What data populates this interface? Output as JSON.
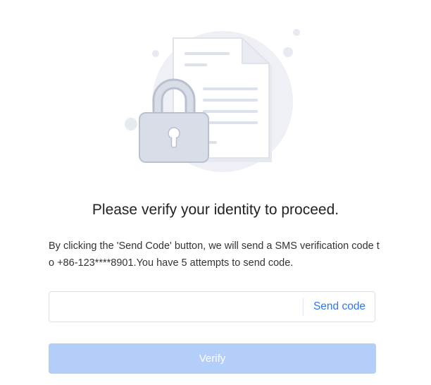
{
  "illustration": {
    "icon": "locked-document-icon",
    "colors": {
      "circle": "#eef0f5",
      "paper": "#ffffff",
      "paper_border": "#dfe3ec",
      "lines": "#dde1ea",
      "lock_body": "#d8dde8",
      "lock_border": "#b9c0cf"
    }
  },
  "title": "Please verify your identity to proceed.",
  "description": "By clicking the 'Send Code' button, we will send a SMS verification code to +86-123****8901.You have 5 attempts to send code.",
  "code_input": {
    "value": "",
    "placeholder": ""
  },
  "send_code_label": "Send code",
  "verify_label": "Verify",
  "colors": {
    "accent": "#2f78e6",
    "verify_disabled": "#b3cef8"
  }
}
